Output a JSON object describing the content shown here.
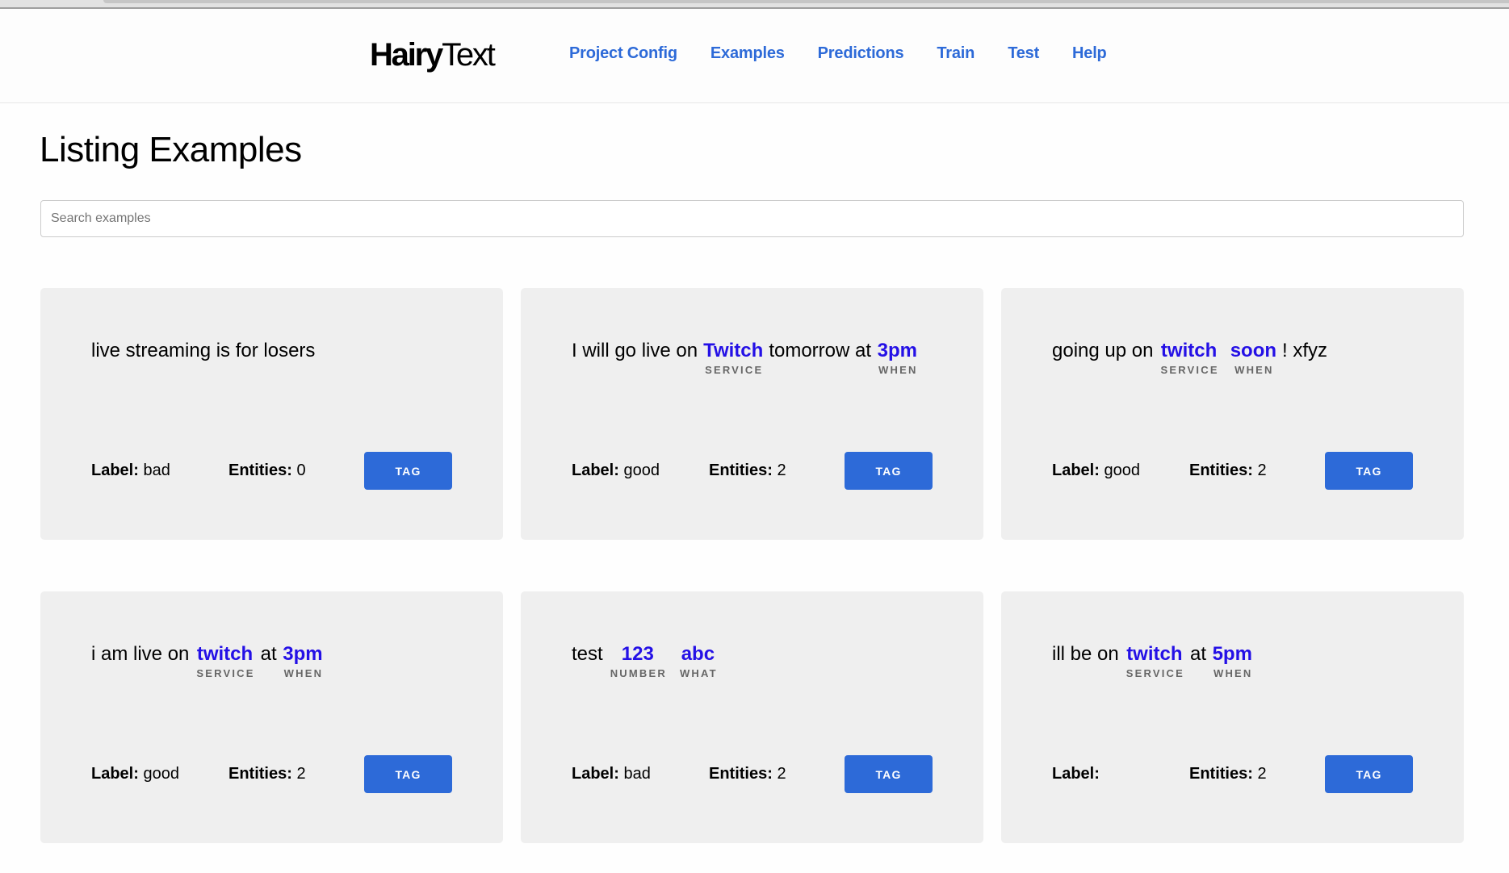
{
  "app": {
    "logo_bold": "Hairy",
    "logo_regular": "Text"
  },
  "nav": {
    "items": [
      {
        "label": "Project Config"
      },
      {
        "label": "Examples"
      },
      {
        "label": "Predictions"
      },
      {
        "label": "Train"
      },
      {
        "label": "Test"
      },
      {
        "label": "Help"
      }
    ],
    "link_color": "#2d6ad8"
  },
  "page": {
    "title": "Listing Examples"
  },
  "search": {
    "placeholder": "Search examples",
    "value": ""
  },
  "card_labels": {
    "label_prefix": "Label:",
    "entities_prefix": "Entities:",
    "tag_button": "TAG"
  },
  "colors": {
    "entity_text": "#2410e6",
    "entity_label": "#666666",
    "button": "#2d6ad8",
    "card_bg": "#efefef"
  },
  "examples": [
    {
      "segments": [
        {
          "text": "live streaming is for losers"
        }
      ],
      "label": "bad",
      "entities": "0"
    },
    {
      "segments": [
        {
          "text": "I will go live on"
        },
        {
          "text": "Twitch",
          "entity": "SERVICE"
        },
        {
          "text": "tomorrow at"
        },
        {
          "text": "3pm",
          "entity": "WHEN"
        }
      ],
      "label": "good",
      "entities": "2"
    },
    {
      "segments": [
        {
          "text": "going up on"
        },
        {
          "text": "twitch",
          "entity": "SERVICE"
        },
        {
          "text": "soon",
          "entity": "WHEN"
        },
        {
          "text": "! xfyz"
        }
      ],
      "label": "good",
      "entities": "2"
    },
    {
      "segments": [
        {
          "text": "i am live on"
        },
        {
          "text": "twitch",
          "entity": "SERVICE"
        },
        {
          "text": "at"
        },
        {
          "text": "3pm",
          "entity": "WHEN"
        }
      ],
      "label": "good",
      "entities": "2"
    },
    {
      "segments": [
        {
          "text": "test"
        },
        {
          "text": "123",
          "entity": "NUMBER"
        },
        {
          "text": "abc",
          "entity": "WHAT"
        }
      ],
      "label": "bad",
      "entities": "2"
    },
    {
      "segments": [
        {
          "text": "ill be on"
        },
        {
          "text": "twitch",
          "entity": "SERVICE"
        },
        {
          "text": "at"
        },
        {
          "text": "5pm",
          "entity": "WHEN"
        }
      ],
      "label": "",
      "entities": "2"
    }
  ]
}
